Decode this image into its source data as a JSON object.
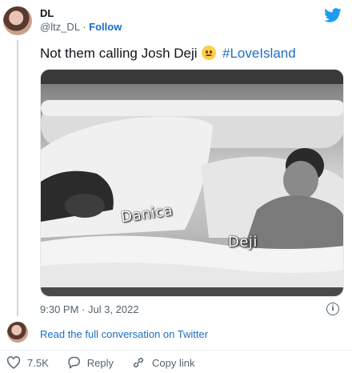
{
  "author": {
    "display_name": "DL",
    "handle": "@ltz_DL",
    "separator": "·",
    "follow_label": "Follow"
  },
  "tweet": {
    "text": "Not them calling Josh Deji",
    "emoji": "worried-face-emoji",
    "hashtag": "#LoveIsland"
  },
  "media": {
    "labels": [
      "Danica",
      "Deji"
    ]
  },
  "meta": {
    "timestamp": "9:30 PM · Jul 3, 2022",
    "info_icon": "i"
  },
  "conversation_link": "Read the full conversation on Twitter",
  "actions": {
    "likes": "7.5K",
    "reply_label": "Reply",
    "copy_label": "Copy link"
  },
  "colors": {
    "brand": "#1d9bf0",
    "link": "#1b6ec2",
    "muted": "#536471"
  }
}
